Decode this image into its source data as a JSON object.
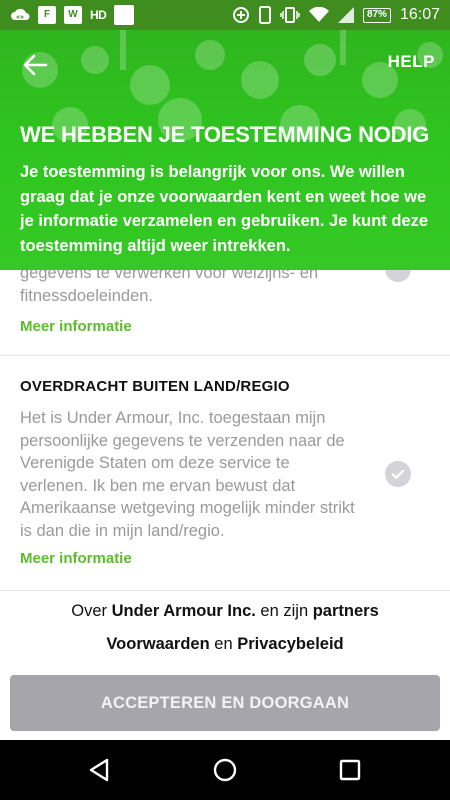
{
  "status_bar": {
    "notification_icons": [
      "cloud-notify-icon",
      "facebook-icon",
      "wordpress-icon",
      "hd-icon",
      "blank-square-icon"
    ],
    "hd_label": "HD",
    "f_label": "F",
    "w_label": "W",
    "system_icons": [
      "data-saver-icon",
      "phone-icon",
      "vibrate-icon",
      "wifi-icon",
      "signal-icon",
      "battery-icon"
    ],
    "battery_percent": "87%",
    "time": "16:07"
  },
  "header": {
    "back_icon": "arrow-left-icon",
    "help_label": "HELP",
    "title": "WE HEBBEN JE TOESTEMMING NODIG",
    "body": "Je toestemming is belangrijk voor ons. We willen graag dat je onze voorwaarden kent en weet hoe we je informatie verzamelen en gebruiken. Je kunt deze toestemming altijd weer intrekken.",
    "accent_color": "#2fc41f"
  },
  "sections": [
    {
      "title": "",
      "text": "gegevens te verwerken voor welzijns- en fitnessdoeleinden.",
      "more_link": "Meer informatie",
      "checked": false
    },
    {
      "title": "OVERDRACHT BUITEN LAND/REGIO",
      "text": "Het is Under Armour, Inc. toegestaan mijn persoonlijke gegevens te verzenden naar de Verenigde Staten om deze service te verlenen. Ik ben me ervan bewust dat Amerikaanse wetgeving mogelijk minder strikt is dan die in mijn land/regio.",
      "more_link": "Meer informatie",
      "checked": false
    }
  ],
  "footer": {
    "line1_prefix": "Over ",
    "line1_link1": "Under Armour Inc.",
    "line1_mid": " en zijn ",
    "line1_link2": "partners",
    "line2_link1": "Voorwaarden",
    "line2_mid": " en ",
    "line2_link2": "Privacybeleid",
    "accept_label": "ACCEPTEREN EN DOORGAAN"
  },
  "nav_bar": {
    "buttons": [
      "back-triangle-icon",
      "home-circle-icon",
      "recents-square-icon"
    ]
  }
}
